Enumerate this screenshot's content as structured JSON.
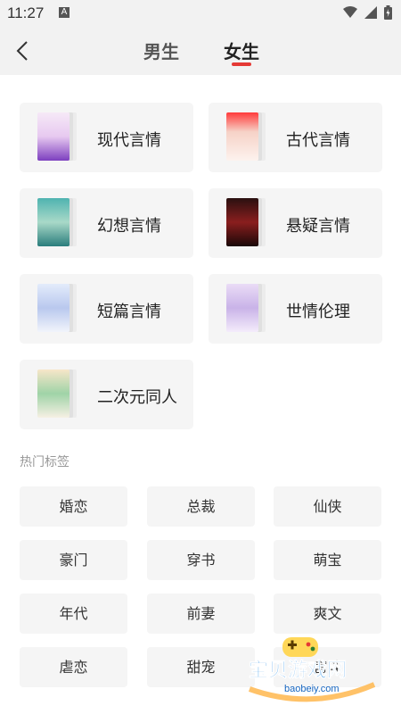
{
  "status_bar": {
    "time": "11:27",
    "indicator": "A",
    "icons": [
      "wifi-icon",
      "signal-icon",
      "battery-icon"
    ]
  },
  "nav": {
    "back_icon": "chevron-left-icon",
    "tabs": [
      {
        "label": "男生",
        "active": false
      },
      {
        "label": "女生",
        "active": true
      }
    ],
    "accent_color": "#e53935"
  },
  "genres": [
    {
      "label": "现代言情"
    },
    {
      "label": "古代言情"
    },
    {
      "label": "幻想言情"
    },
    {
      "label": "悬疑言情"
    },
    {
      "label": "短篇言情"
    },
    {
      "label": "世情伦理"
    },
    {
      "label": "二次元同人"
    }
  ],
  "hot_tags": {
    "title": "热门标签",
    "items": [
      "婚恋",
      "总裁",
      "仙侠",
      "豪门",
      "穿书",
      "萌宝",
      "年代",
      "前妻",
      "爽文",
      "虐恋",
      "甜宠",
      "宫斗"
    ]
  },
  "watermark": {
    "text": "宝贝游戏网",
    "url_text": "baobeiy.com"
  }
}
